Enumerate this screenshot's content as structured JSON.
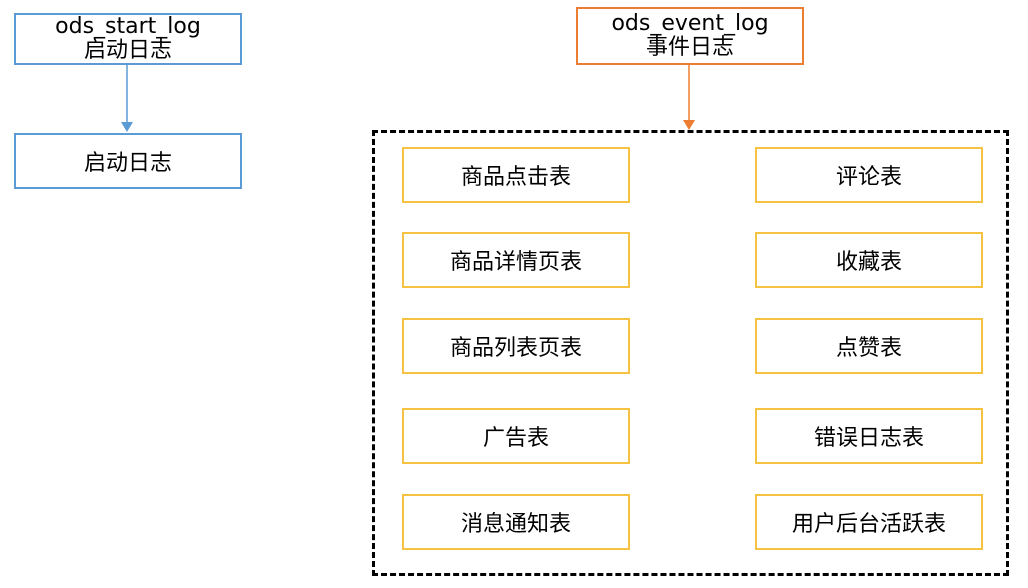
{
  "start_log": {
    "source": {
      "name": "ods_start_log",
      "label": "启动日志"
    },
    "target": {
      "label": "启动日志"
    },
    "color": "#5b9bd5"
  },
  "event_log": {
    "source": {
      "name": "ods_event_log",
      "label": "事件日志"
    },
    "color": "#ed7d31",
    "tables_color": "#f5c242",
    "tables_left": [
      "商品点击表",
      "商品详情页表",
      "商品列表页表",
      "广告表",
      "消息通知表"
    ],
    "tables_right": [
      "评论表",
      "收藏表",
      "点赞表",
      "错误日志表",
      "用户后台活跃表"
    ]
  }
}
